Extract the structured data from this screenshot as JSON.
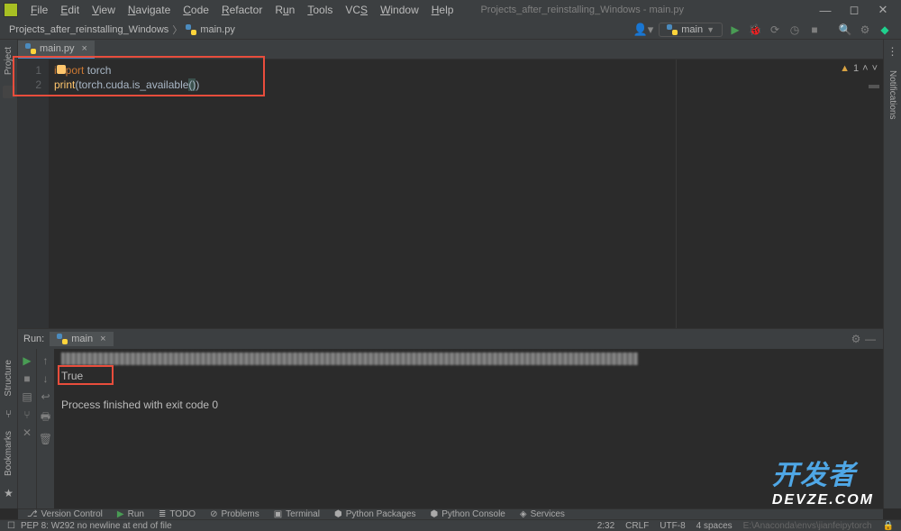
{
  "title": "Projects_after_reinstalling_Windows - main.py",
  "menu": [
    "File",
    "Edit",
    "View",
    "Navigate",
    "Code",
    "Refactor",
    "Run",
    "Tools",
    "VCS",
    "Window",
    "Help"
  ],
  "breadcrumb": {
    "project": "Projects_after_reinstalling_Windows",
    "file": "main.py"
  },
  "run_config": "main",
  "editor_tab": "main.py",
  "code": {
    "lines": [
      "1",
      "2"
    ],
    "l1a": "i",
    "l1b": "port",
    "l1c": " torch",
    "l2a": "print",
    "l2b": "(torch.cuda.is_available",
    "l2c": "(",
    "l2d": ")",
    "l2e": ")"
  },
  "inspections": {
    "warn_count": "1"
  },
  "run": {
    "label": "Run:",
    "tab": "main",
    "cmd_prefix": "\\Anaconda\\envs\\jian",
    "out_true": "True",
    "out_exit": "Process finished with exit code 0"
  },
  "bottom_tools": {
    "vcs": "Version Control",
    "run": "Run",
    "todo": "TODO",
    "problems": "Problems",
    "terminal": "Terminal",
    "pypkg": "Python Packages",
    "pycon": "Python Console",
    "services": "Services"
  },
  "status": {
    "msg": "PEP 8: W292 no newline at end of file",
    "pos": "2:32",
    "eol": "CRLF",
    "enc": "UTF-8",
    "indent": "4 spaces",
    "venv_hint": "E:\\Anaconda\\envs\\jianfeipytorch"
  },
  "gutters": {
    "project": "Project",
    "structure": "Structure",
    "bookmarks": "Bookmarks",
    "notifications": "Notifications"
  },
  "watermark": {
    "cn": "开发者",
    "en": "DEVZE.COM"
  }
}
